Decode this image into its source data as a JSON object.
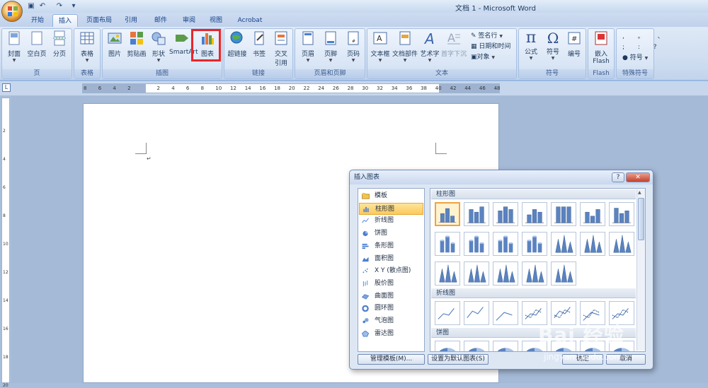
{
  "window": {
    "title": "文档 1 - Microsoft Word"
  },
  "quick_access": {
    "icons": [
      "save-icon",
      "undo-icon",
      "redo-icon",
      "customize-icon"
    ]
  },
  "tabs": [
    {
      "label": "开始"
    },
    {
      "label": "插入",
      "active": true
    },
    {
      "label": "页面布局"
    },
    {
      "label": "引用"
    },
    {
      "label": "邮件"
    },
    {
      "label": "审阅"
    },
    {
      "label": "视图"
    },
    {
      "label": "Acrobat"
    }
  ],
  "ribbon": {
    "groups": {
      "pages": {
        "label": "页",
        "items": [
          "封面",
          "空白页",
          "分页"
        ]
      },
      "tables": {
        "label": "表格",
        "items": [
          "表格"
        ]
      },
      "illustrations": {
        "label": "插图",
        "items": [
          "图片",
          "剪贴画",
          "形状",
          "SmartArt",
          "图表"
        ]
      },
      "links": {
        "label": "链接",
        "items": [
          "超链接",
          "书签",
          "交叉",
          "引用"
        ]
      },
      "header_footer": {
        "label": "页眉和页脚",
        "items": [
          "页眉",
          "页脚",
          "页码"
        ]
      },
      "text": {
        "label": "文本",
        "items": [
          "文本框",
          "文档部件",
          "艺术字",
          "首字下沉"
        ],
        "small_items": [
          "签名行",
          "日期和时间",
          "对象"
        ]
      },
      "symbols": {
        "label": "符号",
        "items": [
          "公式",
          "符号",
          "编号"
        ]
      },
      "flash": {
        "label": "Flash",
        "items": [
          "嵌入",
          "Flash"
        ]
      },
      "special": {
        "label": "特殊符号",
        "items": [
          "符号"
        ]
      }
    }
  },
  "ruler": {
    "numbers": [
      "8",
      "6",
      "4",
      "2",
      "",
      "2",
      "4",
      "6",
      "8",
      "10",
      "12",
      "14",
      "16",
      "18",
      "20",
      "22",
      "24",
      "26",
      "28",
      "30",
      "32",
      "34",
      "36",
      "38",
      "40",
      "42",
      "44",
      "46",
      "48"
    ],
    "vertical_numbers": [
      "2",
      "4",
      "6",
      "8",
      "10",
      "12",
      "14",
      "16",
      "18",
      "20"
    ]
  },
  "dialog": {
    "title": "插入图表",
    "help_label": "?",
    "close_label": "✕",
    "categories": [
      {
        "label": "模板",
        "icon": "folder-icon"
      },
      {
        "label": "柱形图",
        "icon": "column-chart-icon",
        "selected": true
      },
      {
        "label": "折线图",
        "icon": "line-chart-icon"
      },
      {
        "label": "饼图",
        "icon": "pie-chart-icon"
      },
      {
        "label": "条形图",
        "icon": "bar-chart-icon"
      },
      {
        "label": "面积图",
        "icon": "area-chart-icon"
      },
      {
        "label": "X Y (散点图)",
        "icon": "scatter-chart-icon"
      },
      {
        "label": "股价图",
        "icon": "stock-chart-icon"
      },
      {
        "label": "曲面图",
        "icon": "surface-chart-icon"
      },
      {
        "label": "圆环图",
        "icon": "doughnut-chart-icon"
      },
      {
        "label": "气泡图",
        "icon": "bubble-chart-icon"
      },
      {
        "label": "雷达图",
        "icon": "radar-chart-icon"
      }
    ],
    "sections": [
      {
        "label": "柱形图"
      },
      {
        "label": "折线图"
      },
      {
        "label": "饼图"
      }
    ],
    "buttons": {
      "manage_templates": "管理模板(M)...",
      "set_default": "设置为默认图表(S)",
      "ok": "确定",
      "cancel": "取消"
    }
  },
  "watermark": {
    "text": "Bai 经验",
    "url": "jingyan.baidu.com"
  },
  "colors": {
    "accent": "#fbc95c",
    "highlight_red": "#e8262a",
    "column_blue": "#5b83c0"
  }
}
